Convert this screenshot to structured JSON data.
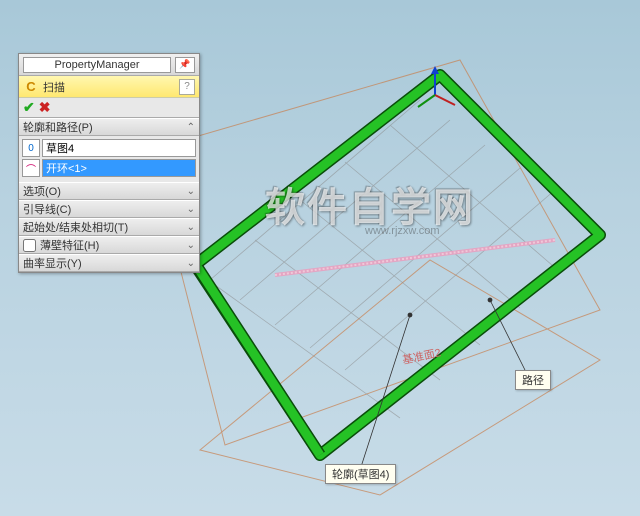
{
  "pm": {
    "title": "PropertyManager",
    "feature_name": "扫描",
    "help": "?",
    "sections": {
      "profile_path": {
        "label": "轮廓和路径(P)",
        "profile_icon": "0",
        "profile_value": "草图4",
        "path_value": "开环<1>"
      },
      "options": {
        "label": "选项(O)"
      },
      "guides": {
        "label": "引导线(C)"
      },
      "tangency": {
        "label": "起始处/结束处相切(T)"
      },
      "thin": {
        "label": "薄壁特征(H)",
        "checked": false
      },
      "curvature": {
        "label": "曲率显示(Y)"
      }
    }
  },
  "viewport": {
    "callout_path": "路径",
    "callout_profile": "轮廓(草图4)",
    "plane_label": "基准面2"
  },
  "watermark": {
    "main": "软件自学网",
    "sub": "www.rjzxw.com"
  }
}
